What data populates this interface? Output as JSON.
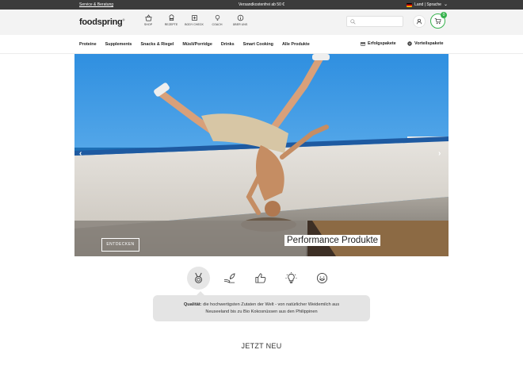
{
  "topbar": {
    "service_link": "Service & Beratung",
    "shipping": "Versandkostenfrei ab 50 €",
    "country_language": "Land | Sprache"
  },
  "header": {
    "logo": "foodspring",
    "logo_mark": "®",
    "nav": [
      {
        "label": "SHOP",
        "icon": "basket-icon"
      },
      {
        "label": "REZEPTE",
        "icon": "chef-hat-icon"
      },
      {
        "label": "BODY CHECK",
        "icon": "body-check-icon"
      },
      {
        "label": "COACH",
        "icon": "lightbulb-icon"
      },
      {
        "label": "ÜBER UNS",
        "icon": "info-icon"
      }
    ],
    "search_placeholder": "",
    "cart_count": "0"
  },
  "categories": [
    "Proteine",
    "Supplements",
    "Snacks & Riegel",
    "Müsli/Porridge",
    "Drinks",
    "Smart Cooking",
    "Alle Produkte"
  ],
  "category_right": {
    "erfolgspakete": "Erfolgspakete",
    "vorteilspakete": "Vorteilspakete"
  },
  "hero": {
    "title": "Performance Produkte",
    "cta": "ENTDECKEN",
    "prev": "‹",
    "next": "›"
  },
  "features": [
    {
      "icon": "medal-icon",
      "active": true
    },
    {
      "icon": "leaf-hand-icon",
      "active": false
    },
    {
      "icon": "thumbs-up-icon",
      "active": false
    },
    {
      "icon": "lightbulb-icon",
      "active": false
    },
    {
      "icon": "smiley-icon",
      "active": false
    }
  ],
  "feature_info": {
    "label": "Qualität:",
    "line1": " die hochwertigsten Zutaten der Welt - von natürlicher Weidemilch aus",
    "line2": "Neuseeland bis zu Bio Kokosnüssen aus den Philippinen"
  },
  "section_title": "JETZT NEU",
  "colors": {
    "accent_green": "#37b24d",
    "topbar": "#3b3b3b",
    "header_bg": "#f3f3f3"
  }
}
